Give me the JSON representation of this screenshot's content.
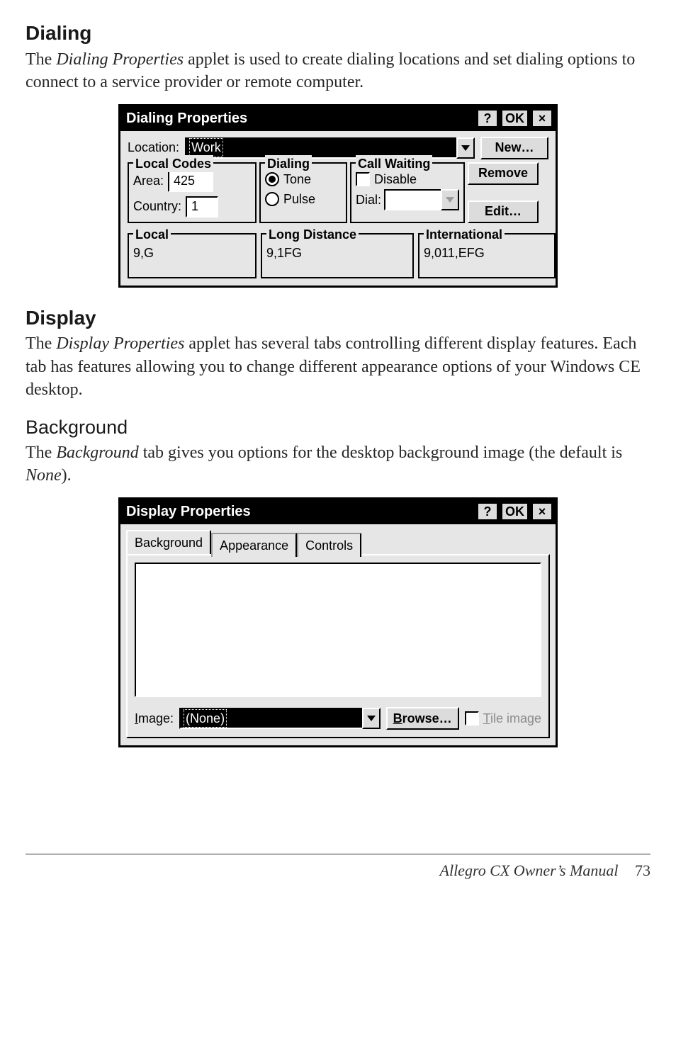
{
  "sections": {
    "dialing_heading": "Dialing",
    "dialing_para_pre": "The ",
    "dialing_para_em": "Dialing Properties",
    "dialing_para_post": " applet is used to create dialing locations and set dialing options to connect to a service provider or remote computer.",
    "display_heading": "Display",
    "display_para_pre": "The ",
    "display_para_em": "Display Properties",
    "display_para_post": " applet has several tabs controlling different display features. Each tab has features allowing you to change different appearance options of your Windows CE desktop.",
    "background_heading": "Background",
    "background_para_pre": "The ",
    "background_para_em": "Background",
    "background_para_mid": " tab gives you options for the desktop background image (the default is ",
    "background_para_em2": "None",
    "background_para_end": ")."
  },
  "dialing": {
    "title": "Dialing Properties",
    "help": "?",
    "ok": "OK",
    "close": "×",
    "location_label": "Location:",
    "location_value": "Work",
    "new_btn": "New…",
    "remove_btn": "Remove",
    "edit_btn": "Edit…",
    "local_codes_legend": "Local Codes",
    "area_label": "Area:",
    "area_value": "425",
    "country_label": "Country:",
    "country_value": "1",
    "dialing_legend": "Dialing",
    "tone": "Tone",
    "pulse": "Pulse",
    "call_waiting_legend": "Call Waiting",
    "disable": "Disable",
    "dial_label": "Dial:",
    "dial_value": "",
    "local_legend": "Local",
    "local_value": "9,G",
    "ld_legend": "Long Distance",
    "ld_value": "9,1FG",
    "intl_legend": "International",
    "intl_value": "9,011,EFG"
  },
  "display": {
    "title": "Display Properties",
    "help": "?",
    "ok": "OK",
    "close": "×",
    "tabs": {
      "background": "Background",
      "appearance": "Appearance",
      "controls": "Controls"
    },
    "image_label_pre": "I",
    "image_label_post": "mage:",
    "image_value": "(None)",
    "browse_pre": "B",
    "browse_post": "rowse…",
    "tile_pre": "T",
    "tile_post": "ile image"
  },
  "footer": {
    "text": "Allegro CX Owner’s Manual",
    "page": "73"
  }
}
